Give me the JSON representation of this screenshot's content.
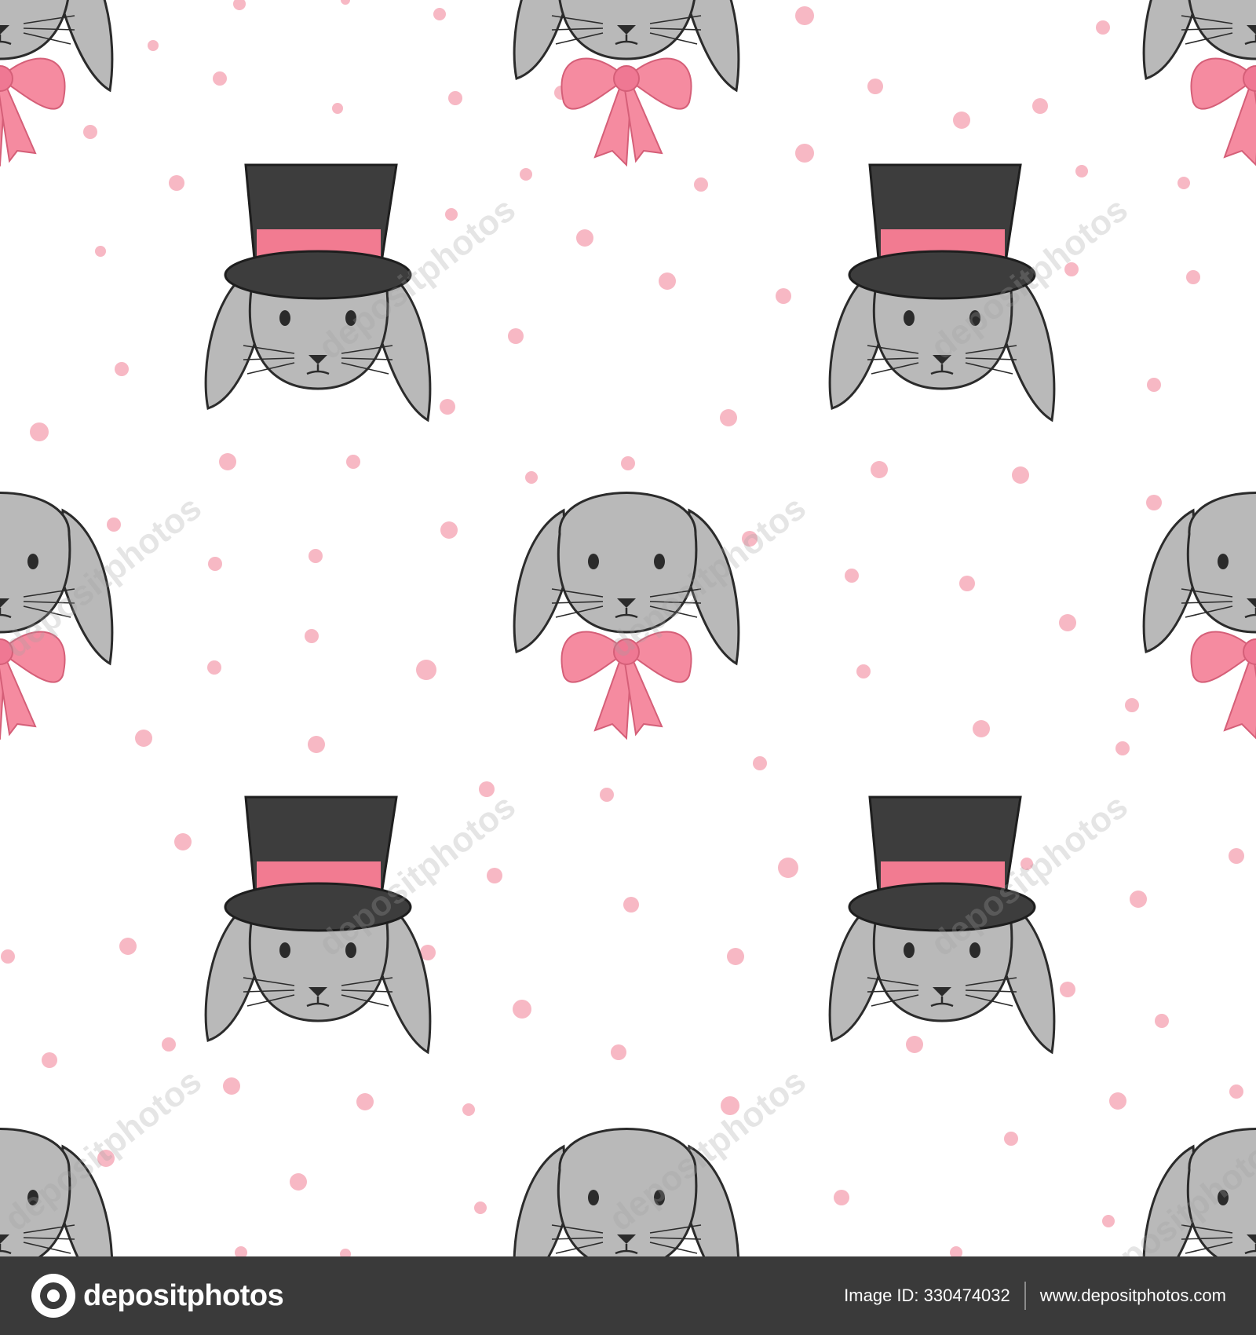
{
  "pattern": {
    "description_tags": [
      "bunny-top-hat",
      "bunny-bow",
      "pink-dot"
    ],
    "colors": {
      "background": "#ffffff",
      "bunny_fill": "#b9b9b9",
      "bunny_outline": "#2b2b2b",
      "hat": "#3d3d3d",
      "hat_band": "#f27b91",
      "bow": "#f58ba0",
      "dots": "#f7b8c4"
    },
    "watermark_text": "depositphotos"
  },
  "footer": {
    "logo_text": "depositphotos",
    "image_id_label": "Image ID: 330474032",
    "site_url": "www.depositphotos.com"
  }
}
